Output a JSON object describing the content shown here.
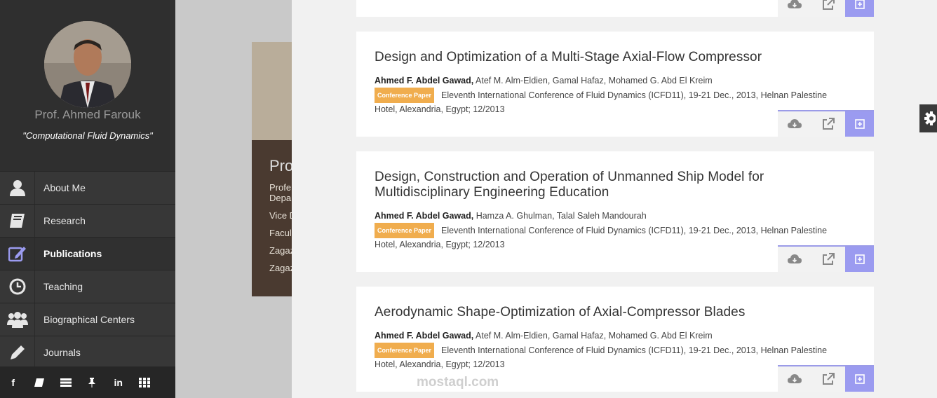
{
  "profile": {
    "name": "Prof. Ahmed Farouk",
    "tagline": "\"Computational Fluid Dynamics\""
  },
  "nav": {
    "items": [
      {
        "label": "About Me",
        "icon": "user-icon"
      },
      {
        "label": "Research",
        "icon": "book-icon"
      },
      {
        "label": "Publications",
        "icon": "edit-icon",
        "active": true
      },
      {
        "label": "Teaching",
        "icon": "clock-icon"
      },
      {
        "label": "Biographical Centers",
        "icon": "users-icon"
      },
      {
        "label": "Journals",
        "icon": "pencil-icon"
      }
    ]
  },
  "social": [
    "f",
    "book-icon",
    "list-icon",
    "pin-icon",
    "in",
    "grid-icon"
  ],
  "hero": {
    "title_fragment": "Pro",
    "lines": [
      "Profe",
      "Depa",
      "Vice D",
      "Facul",
      "Zagaz",
      "Zagaz"
    ]
  },
  "publications": [
    {
      "title": "Design and Optimization of a Multi-Stage Axial-Flow Compressor",
      "lead_author": "Ahmed F. Abdel Gawad,",
      "coauthors": " Atef M. Alm-Eldien, Gamal Hafaz, Mohamed G. Abd El Kreim",
      "badge": "Conference Paper",
      "venue": "Eleventh International Conference of Fluid Dynamics (ICFD11), 19-21 Dec., 2013, Helnan Palestine Hotel, Alexandria, Egypt; 12/2013"
    },
    {
      "title": "Design, Construction and Operation of Unmanned Ship Model for Multidisciplinary Engineering Education",
      "lead_author": "Ahmed F. Abdel Gawad,",
      "coauthors": " Hamza A. Ghulman, Talal Saleh Mandourah",
      "badge": "Conference Paper",
      "venue": "Eleventh International Conference of Fluid Dynamics (ICFD11), 19-21 Dec., 2013, Helnan Palestine Hotel, Alexandria, Egypt; 12/2013"
    },
    {
      "title": "Aerodynamic Shape-Optimization of Axial-Compressor Blades",
      "lead_author": "Ahmed F. Abdel Gawad,",
      "coauthors": " Atef M. Alm-Eldien, Gamal Hafaz, Mohamed G. Abd El Kreim",
      "badge": "Conference Paper",
      "venue": "Eleventh International Conference of Fluid Dynamics (ICFD11), 19-21 Dec., 2013, Helnan Palestine Hotel, Alexandria, Egypt; 12/2013"
    }
  ],
  "watermark": "mostaql.com",
  "colors": {
    "accent": "#9b9bf0",
    "badge": "#f0ad4e",
    "sidebar": "#2f2f2f"
  }
}
